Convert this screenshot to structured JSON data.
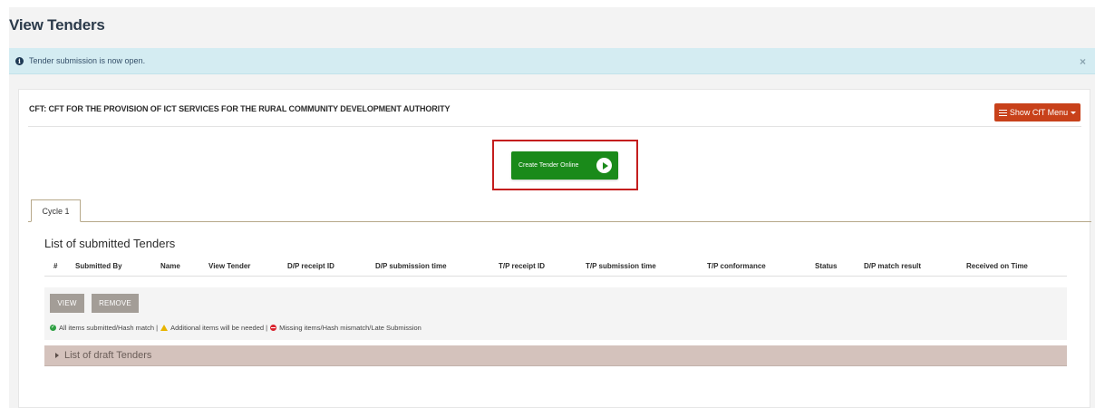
{
  "page": {
    "title": "View Tenders"
  },
  "alert": {
    "icon": "info-icon",
    "message": "Tender submission is now open.",
    "close_label": "×"
  },
  "panel": {
    "cft_title": "CFT: CFT FOR THE PROVISION OF ICT SERVICES FOR THE RURAL COMMUNITY DEVELOPMENT AUTHORITY",
    "cft_menu_label": "Show CfT Menu",
    "create_tender_label": "Create Tender Online"
  },
  "tabs": [
    {
      "label": "Cycle 1",
      "active": true
    }
  ],
  "submitted": {
    "title": "List of submitted Tenders",
    "columns": [
      "#",
      "Submitted By",
      "Name",
      "View Tender",
      "D/P receipt ID",
      "D/P submission time",
      "T/P receipt ID",
      "T/P submission time",
      "T/P conformance",
      "Status",
      "D/P match result",
      "Received on Time"
    ],
    "view_label": "VIEW",
    "remove_label": "REMOVE",
    "legend": {
      "ok": "All items submitted/Hash match |",
      "warn": "Additional items will be needed |",
      "err": "Missing items/Hash mismatch/Late Submission"
    }
  },
  "drafts": {
    "label": "List of draft Tenders"
  },
  "colors": {
    "alert_bg": "#d4ecf2",
    "menu_button": "#c8411a",
    "create_button": "#1a8a1a",
    "highlight": "#c41e1e",
    "grey_button": "#a39d97",
    "draft_bar": "#d4c2bc"
  }
}
